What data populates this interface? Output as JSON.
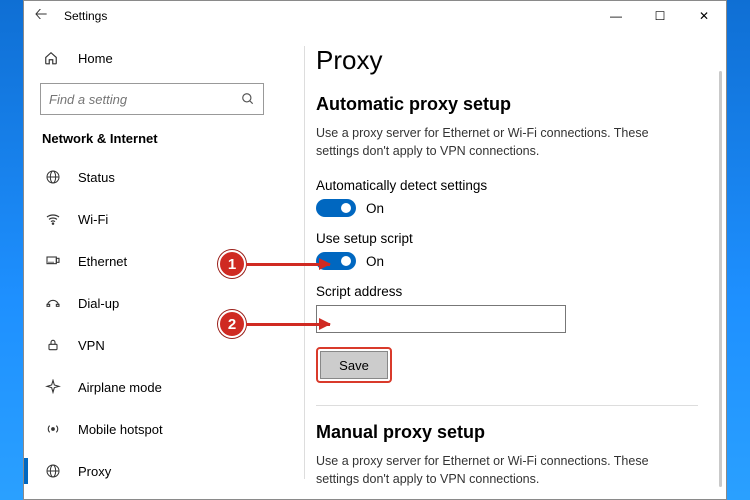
{
  "window": {
    "title": "Settings",
    "min": "—",
    "max": "☐",
    "close": "✕"
  },
  "sidebar": {
    "home": "Home",
    "search_placeholder": "Find a setting",
    "category": "Network & Internet",
    "items": [
      {
        "icon": "status-icon",
        "label": "Status"
      },
      {
        "icon": "wifi-icon",
        "label": "Wi-Fi"
      },
      {
        "icon": "ethernet-icon",
        "label": "Ethernet"
      },
      {
        "icon": "dialup-icon",
        "label": "Dial-up"
      },
      {
        "icon": "vpn-icon",
        "label": "VPN"
      },
      {
        "icon": "airplane-icon",
        "label": "Airplane mode"
      },
      {
        "icon": "hotspot-icon",
        "label": "Mobile hotspot"
      },
      {
        "icon": "proxy-icon",
        "label": "Proxy"
      }
    ],
    "selected_index": 7
  },
  "main": {
    "title": "Proxy",
    "auto": {
      "heading": "Automatic proxy setup",
      "desc": "Use a proxy server for Ethernet or Wi-Fi connections. These settings don't apply to VPN connections.",
      "detect_label": "Automatically detect settings",
      "detect_state": "On",
      "script_label": "Use setup script",
      "script_state": "On",
      "address_label": "Script address",
      "address_value": "",
      "save": "Save"
    },
    "manual": {
      "heading": "Manual proxy setup",
      "desc": "Use a proxy server for Ethernet or Wi-Fi connections. These settings don't apply to VPN connections."
    }
  },
  "callouts": {
    "one": "1",
    "two": "2"
  }
}
